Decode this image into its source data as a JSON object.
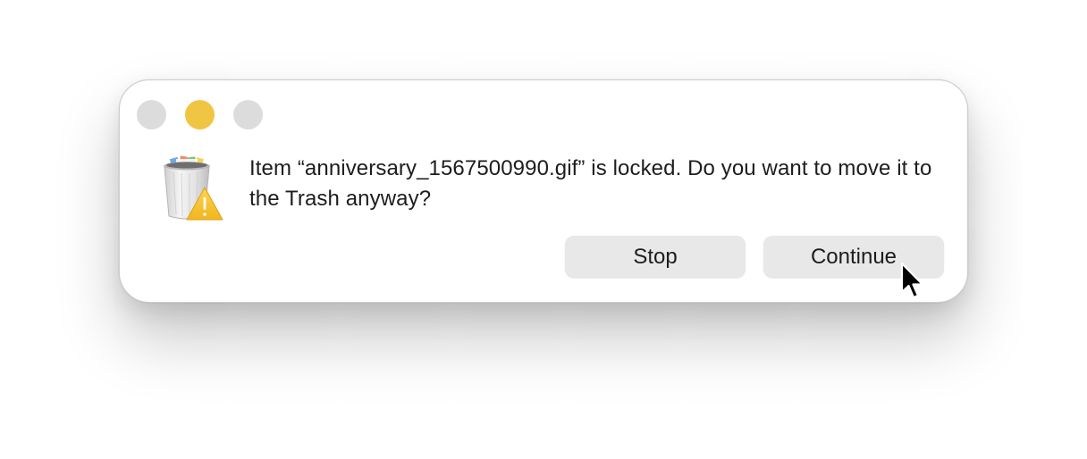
{
  "window": {
    "controls": [
      {
        "name": "close",
        "color": "#dcdcdc"
      },
      {
        "name": "minimize",
        "color": "#f0c544"
      },
      {
        "name": "zoom",
        "color": "#dcdcdc"
      }
    ]
  },
  "alert": {
    "icon": "locked-trash-warning-icon",
    "message": "Item “anniversary_1567500990.gif” is locked. Do you want to move it to the Trash anyway?"
  },
  "buttons": {
    "stop_label": "Stop",
    "continue_label": "Continue"
  },
  "pointer": {
    "icon": "arrow-cursor-icon"
  }
}
